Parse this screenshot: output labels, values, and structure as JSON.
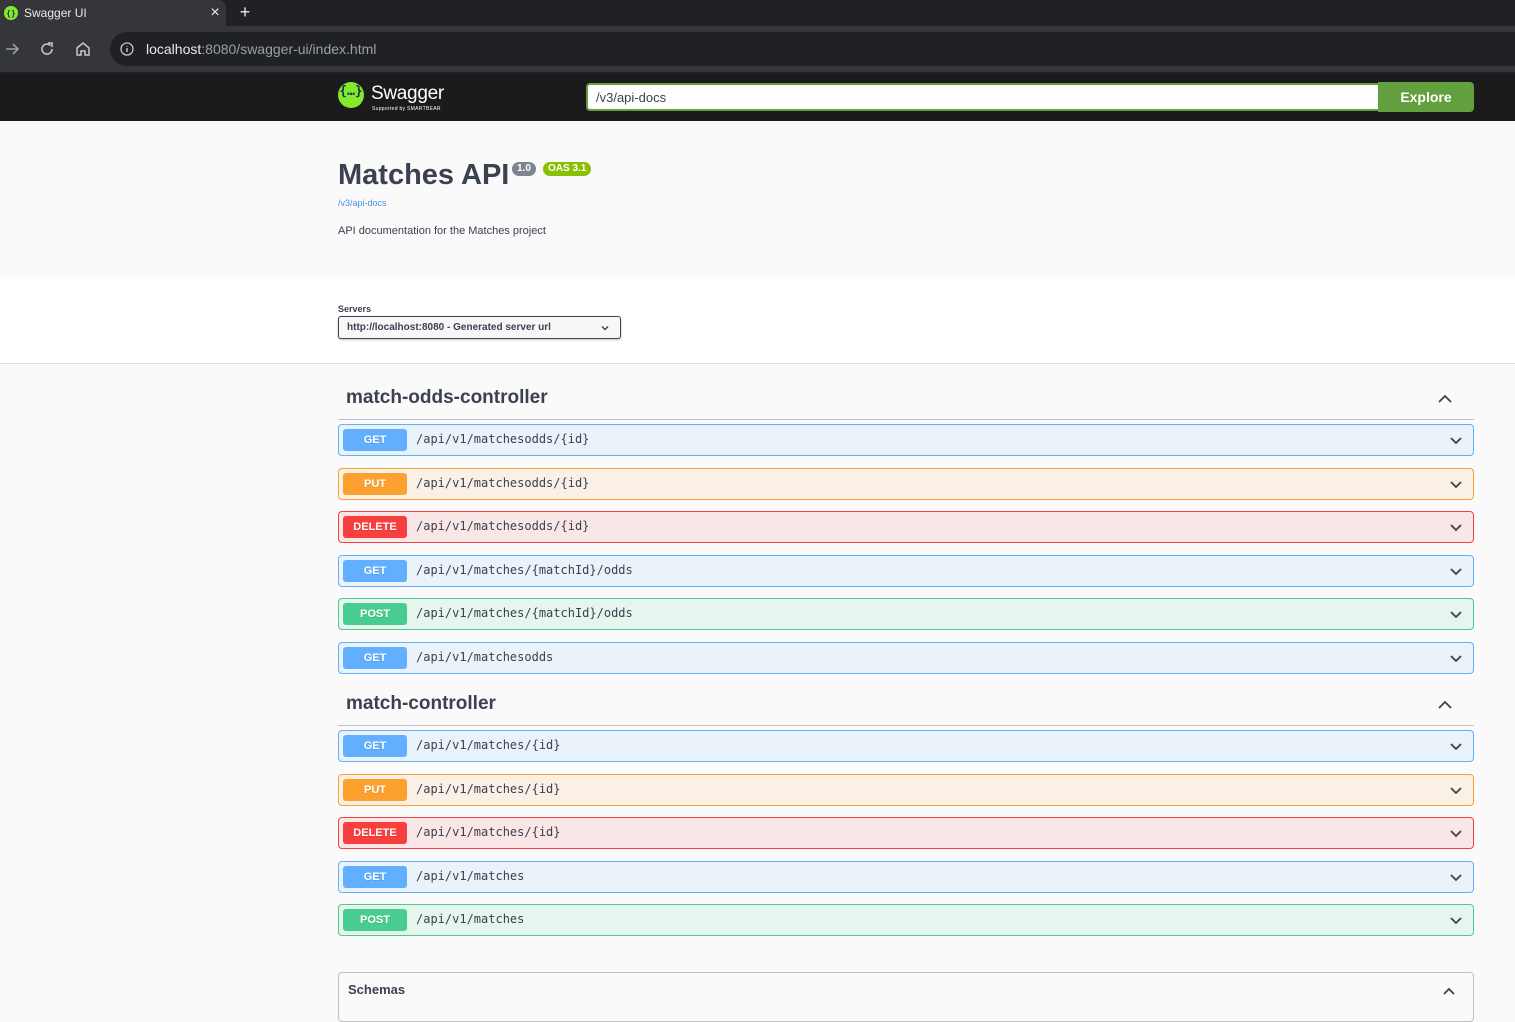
{
  "browser": {
    "tab_title": "Swagger UI",
    "url_host": "localhost",
    "url_rest": ":8080/swagger-ui/index.html"
  },
  "topbar": {
    "logo_text": "Swagger",
    "logo_subtext": "Supported by SMARTBEAR",
    "spec_url": "/v3/api-docs",
    "explore_label": "Explore"
  },
  "info": {
    "title": "Matches API",
    "version": "1.0",
    "oas": "OAS 3.1",
    "spec_link": "/v3/api-docs",
    "description": "API documentation for the Matches project"
  },
  "servers": {
    "label": "Servers",
    "selected": "http://localhost:8080 - Generated server url"
  },
  "tags": [
    {
      "name": "match-odds-controller",
      "operations": [
        {
          "method": "GET",
          "path": "/api/v1/matchesodds/{id}"
        },
        {
          "method": "PUT",
          "path": "/api/v1/matchesodds/{id}"
        },
        {
          "method": "DELETE",
          "path": "/api/v1/matchesodds/{id}"
        },
        {
          "method": "GET",
          "path": "/api/v1/matches/{matchId}/odds"
        },
        {
          "method": "POST",
          "path": "/api/v1/matches/{matchId}/odds"
        },
        {
          "method": "GET",
          "path": "/api/v1/matchesodds"
        }
      ]
    },
    {
      "name": "match-controller",
      "operations": [
        {
          "method": "GET",
          "path": "/api/v1/matches/{id}"
        },
        {
          "method": "PUT",
          "path": "/api/v1/matches/{id}"
        },
        {
          "method": "DELETE",
          "path": "/api/v1/matches/{id}"
        },
        {
          "method": "GET",
          "path": "/api/v1/matches"
        },
        {
          "method": "POST",
          "path": "/api/v1/matches"
        }
      ]
    }
  ],
  "schemas": {
    "title": "Schemas"
  },
  "colors": {
    "get": "#61affe",
    "put": "#fca130",
    "delete": "#f93e3e",
    "post": "#49cc90",
    "explore": "#62a03f",
    "swagger_green": "#85ea2d"
  }
}
